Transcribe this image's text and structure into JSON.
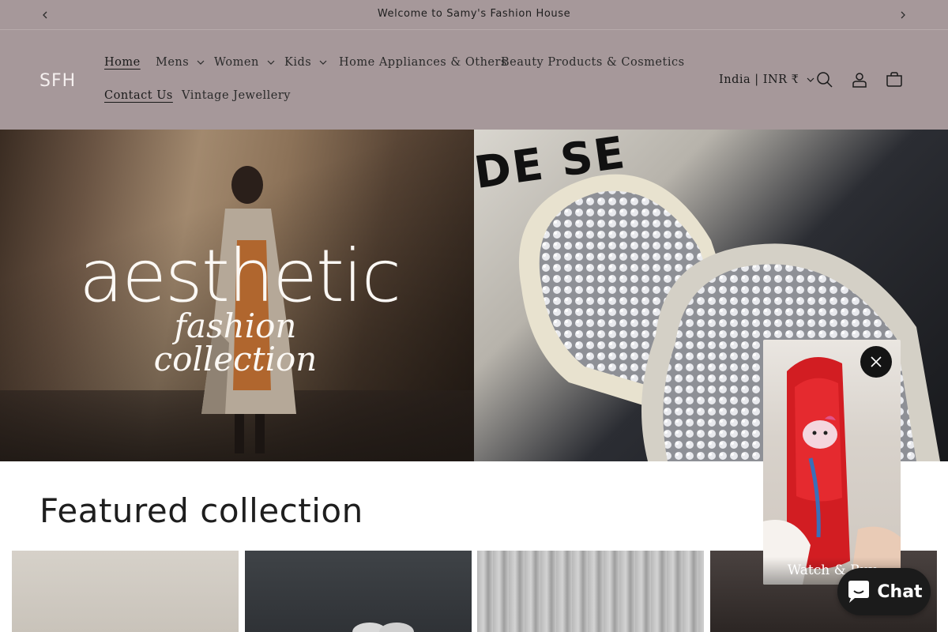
{
  "announcement": {
    "message": "Welcome to Samy's Fashion House",
    "prev_icon": "chevron-left-icon",
    "next_icon": "chevron-right-icon"
  },
  "header": {
    "logo": "SFH",
    "nav": [
      {
        "label": "Home",
        "has_dropdown": false,
        "active": true
      },
      {
        "label": "Mens",
        "has_dropdown": true
      },
      {
        "label": "Women",
        "has_dropdown": true
      },
      {
        "label": "Kids",
        "has_dropdown": true
      },
      {
        "label": "Home Appliances & Others",
        "has_dropdown": false
      },
      {
        "label": "Beauty Products & Cosmetics",
        "has_dropdown": false
      },
      {
        "label": "Contact Us",
        "has_dropdown": false,
        "underlined": true
      },
      {
        "label": "Vintage Jewellery",
        "has_dropdown": false
      }
    ],
    "locale": "India | INR ₹",
    "icons": [
      "search-icon",
      "account-icon",
      "cart-icon"
    ]
  },
  "hero": {
    "left_brand": "aesthetic",
    "left_sub": "fashion collection",
    "right_box_text": "DE SE"
  },
  "featured": {
    "title": "Featured collection"
  },
  "video_popup": {
    "caption": "Watch & Buy",
    "close_icon": "close-icon"
  },
  "chat": {
    "label": "Chat",
    "icon": "chat-bubble-icon"
  },
  "colors": {
    "header_bg": "#a6989a",
    "text": "#1e1e1e",
    "chat_bg": "#1b1b1b"
  }
}
